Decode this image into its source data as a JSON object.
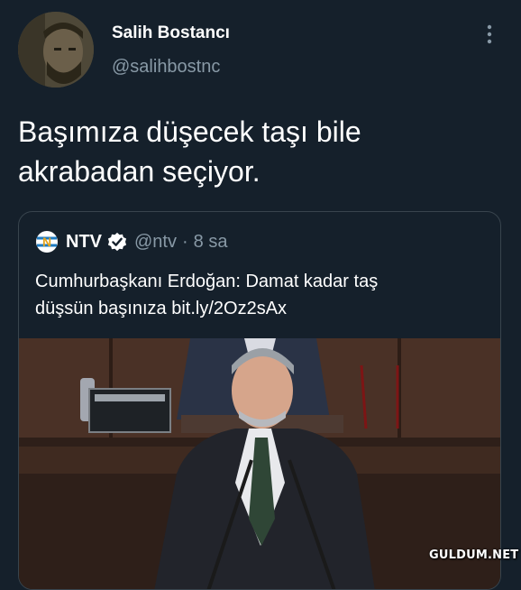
{
  "tweet": {
    "author": {
      "name": "Salih Bostancı",
      "handle": "@salihbostnc"
    },
    "text_lines": [
      "Başımıza düşecek taşı bile",
      "akrabadan seçiyor."
    ]
  },
  "quoted_tweet": {
    "name": "NTV",
    "verified": true,
    "handle": "@ntv",
    "separator": "·",
    "time": "8 sa",
    "text_lines": [
      "Cumhurbaşkanı Erdoğan: Damat kadar taş",
      "düşsün başınıza bit.ly/2Oz2sAx"
    ],
    "media_description_icon": "photo"
  },
  "icons": {
    "more": "vertical-ellipsis-icon",
    "verified": "verified-badge-icon",
    "logo": "ntv-logo-icon"
  },
  "colors": {
    "background": "#15202b",
    "secondary_text": "#8899a6",
    "border": "#38444d",
    "verified": "#ffffff"
  },
  "watermark": "GULDUM.NET"
}
